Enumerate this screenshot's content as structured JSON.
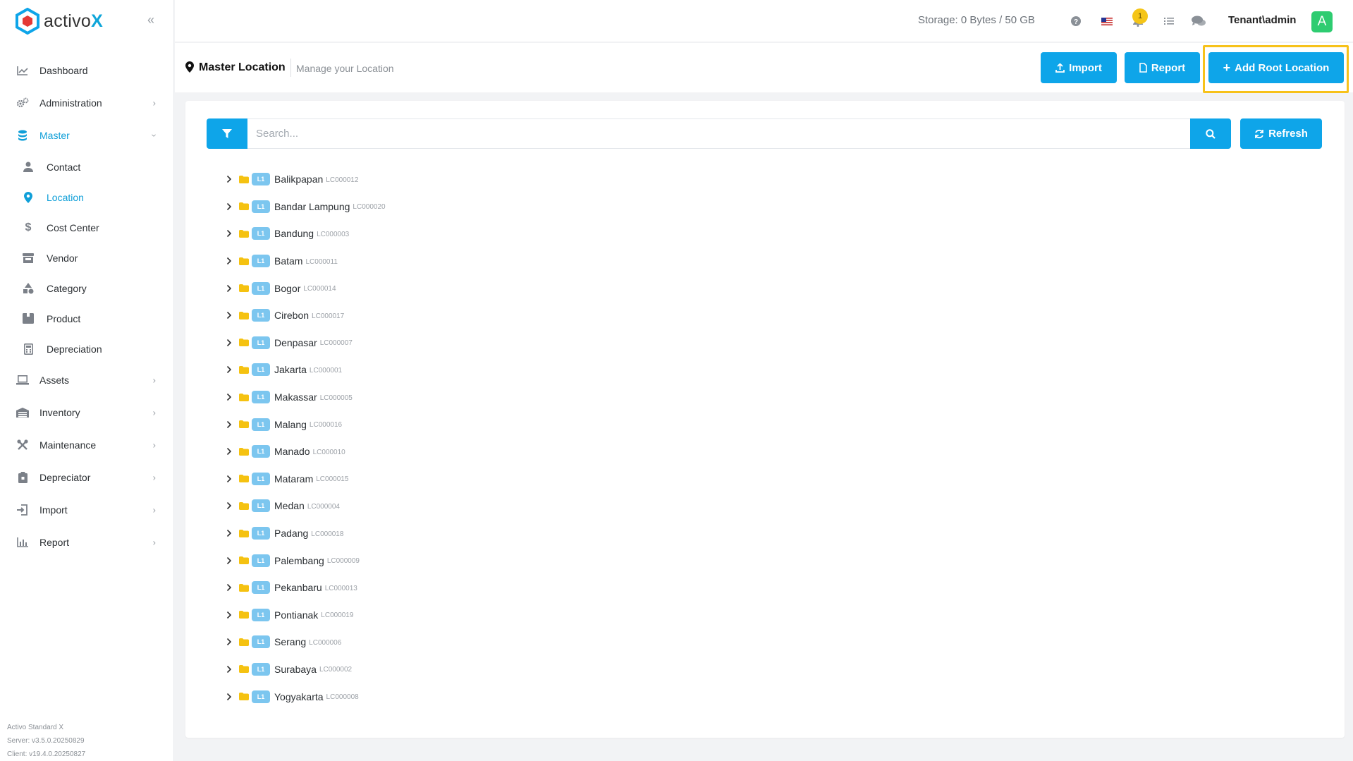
{
  "app": {
    "logo_text": "activo",
    "logo_x": "X",
    "brand_color": "#0ea5e9"
  },
  "topbar": {
    "storage": "Storage: 0 Bytes / 50 GB",
    "notification_count": "1",
    "user": "Tenant\\admin",
    "avatar_letter": "A"
  },
  "sidebar": {
    "items": [
      {
        "label": "Dashboard",
        "icon": "chart-line-icon"
      },
      {
        "label": "Administration",
        "icon": "gears-icon"
      },
      {
        "label": "Master",
        "icon": "database-icon"
      },
      {
        "label": "Assets",
        "icon": "laptop-icon"
      },
      {
        "label": "Inventory",
        "icon": "warehouse-icon"
      },
      {
        "label": "Maintenance",
        "icon": "tools-icon"
      },
      {
        "label": "Depreciator",
        "icon": "clipboard-icon"
      },
      {
        "label": "Import",
        "icon": "import-icon"
      },
      {
        "label": "Report",
        "icon": "bar-chart-icon"
      }
    ],
    "master_sub": [
      {
        "label": "Contact",
        "icon": "user-icon"
      },
      {
        "label": "Location",
        "icon": "map-pin-icon"
      },
      {
        "label": "Cost Center",
        "icon": "dollar-icon"
      },
      {
        "label": "Vendor",
        "icon": "store-icon"
      },
      {
        "label": "Category",
        "icon": "shapes-icon"
      },
      {
        "label": "Product",
        "icon": "box-icon"
      },
      {
        "label": "Depreciation",
        "icon": "calculator-icon"
      }
    ],
    "footer": {
      "edition": "Activo Standard X",
      "server": "Server: v3.5.0.20250829",
      "client": "Client: v19.4.0.20250827"
    }
  },
  "page": {
    "title": "Master Location",
    "subtitle": "Manage your Location",
    "buttons": {
      "import": "Import",
      "report": "Report",
      "add_root": "Add Root Location",
      "refresh": "Refresh"
    },
    "search_placeholder": "Search..."
  },
  "tree": [
    {
      "level": "L1",
      "name": "Balikpapan",
      "code": "LC000012"
    },
    {
      "level": "L1",
      "name": "Bandar Lampung",
      "code": "LC000020"
    },
    {
      "level": "L1",
      "name": "Bandung",
      "code": "LC000003"
    },
    {
      "level": "L1",
      "name": "Batam",
      "code": "LC000011"
    },
    {
      "level": "L1",
      "name": "Bogor",
      "code": "LC000014"
    },
    {
      "level": "L1",
      "name": "Cirebon",
      "code": "LC000017"
    },
    {
      "level": "L1",
      "name": "Denpasar",
      "code": "LC000007"
    },
    {
      "level": "L1",
      "name": "Jakarta",
      "code": "LC000001"
    },
    {
      "level": "L1",
      "name": "Makassar",
      "code": "LC000005"
    },
    {
      "level": "L1",
      "name": "Malang",
      "code": "LC000016"
    },
    {
      "level": "L1",
      "name": "Manado",
      "code": "LC000010"
    },
    {
      "level": "L1",
      "name": "Mataram",
      "code": "LC000015"
    },
    {
      "level": "L1",
      "name": "Medan",
      "code": "LC000004"
    },
    {
      "level": "L1",
      "name": "Padang",
      "code": "LC000018"
    },
    {
      "level": "L1",
      "name": "Palembang",
      "code": "LC000009"
    },
    {
      "level": "L1",
      "name": "Pekanbaru",
      "code": "LC000013"
    },
    {
      "level": "L1",
      "name": "Pontianak",
      "code": "LC000019"
    },
    {
      "level": "L1",
      "name": "Serang",
      "code": "LC000006"
    },
    {
      "level": "L1",
      "name": "Surabaya",
      "code": "LC000002"
    },
    {
      "level": "L1",
      "name": "Yogyakarta",
      "code": "LC000008"
    }
  ]
}
